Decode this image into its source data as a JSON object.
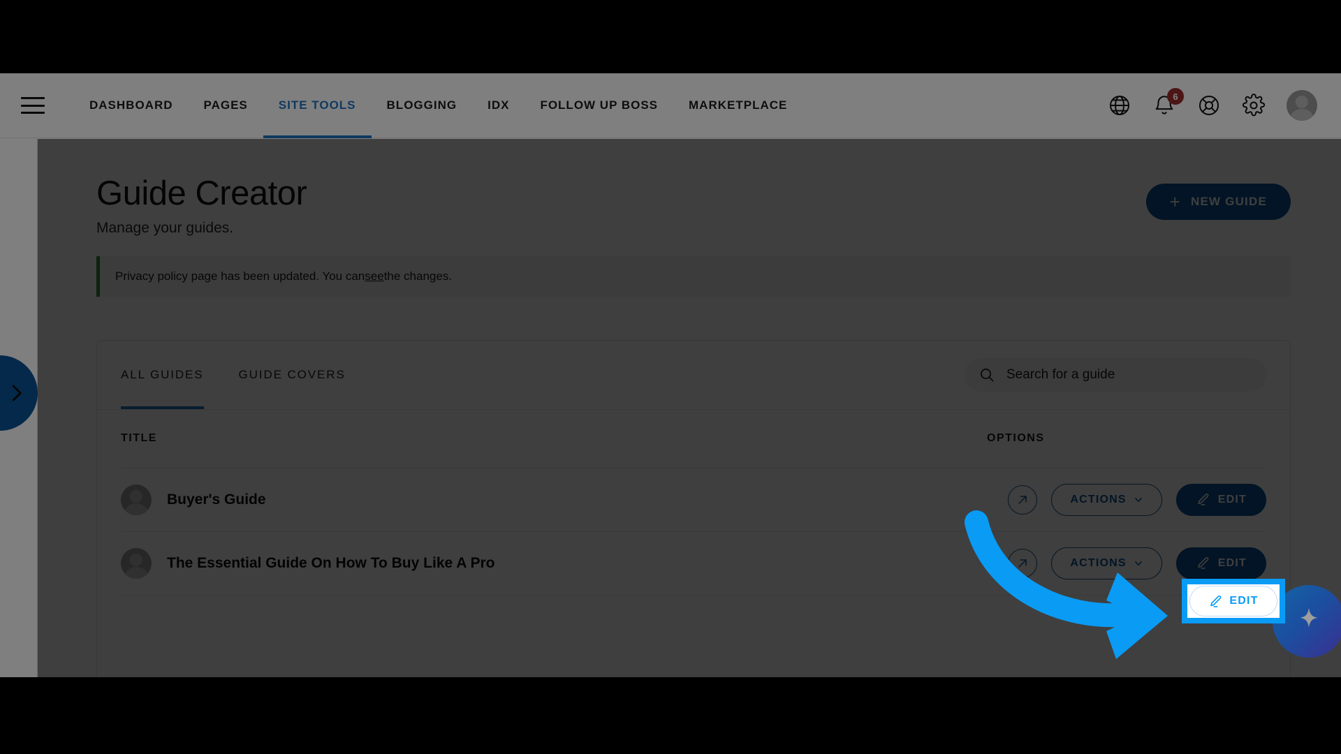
{
  "app": {
    "accent_blue": "#0b5394",
    "link_blue": "#1e73be",
    "highlight_blue": "#0a9bf5",
    "notice_green": "#2e8b3d",
    "badge_red": "#9b2c2c"
  },
  "topnav": {
    "menu_icon": "hamburger-icon",
    "items": [
      {
        "label": "DASHBOARD",
        "active": false
      },
      {
        "label": "PAGES",
        "active": false
      },
      {
        "label": "SITE TOOLS",
        "active": true
      },
      {
        "label": "BLOGGING",
        "active": false
      },
      {
        "label": "IDX",
        "active": false
      },
      {
        "label": "FOLLOW UP BOSS",
        "active": false
      },
      {
        "label": "MARKETPLACE",
        "active": false
      }
    ],
    "icons": [
      {
        "name": "globe-icon"
      },
      {
        "name": "bell-icon",
        "badge": "6"
      },
      {
        "name": "lifebuoy-help-icon"
      },
      {
        "name": "gear-settings-icon"
      },
      {
        "name": "user-avatar"
      }
    ],
    "notification_count": "6"
  },
  "leftrail": {
    "toggle_icon": "chevron-right-icon"
  },
  "header": {
    "title": "Guide Creator",
    "subtitle": "Manage your guides.",
    "new_guide_label": "NEW GUIDE",
    "new_guide_icon": "plus-icon"
  },
  "notice": {
    "text_before": "Privacy policy page has been updated. You can ",
    "link": "see",
    "text_after": " the changes."
  },
  "card": {
    "tabs": [
      {
        "label": "ALL GUIDES",
        "active": true
      },
      {
        "label": "GUIDE COVERS",
        "active": false
      }
    ],
    "search": {
      "placeholder": "Search for a guide",
      "value": "",
      "icon": "search-icon"
    },
    "table": {
      "columns": [
        "TITLE",
        "OPTIONS"
      ],
      "rows": [
        {
          "title": "Buyer's Guide",
          "avatar": "user-avatar",
          "open_icon": "external-link-icon",
          "actions_label": "ACTIONS",
          "actions_caret": "chevron-down-icon",
          "edit_label": "EDIT",
          "edit_icon": "pencil-icon"
        },
        {
          "title": "The Essential Guide On How To Buy Like A Pro",
          "avatar": "user-avatar",
          "open_icon": "external-link-icon",
          "actions_label": "ACTIONS",
          "actions_caret": "chevron-down-icon",
          "edit_label": "EDIT",
          "edit_icon": "pencil-icon"
        }
      ]
    }
  },
  "annotation": {
    "arrow": "curved-blue-arrow",
    "spotlight_target": "EDIT",
    "spotlight_icon": "pencil-icon"
  },
  "fab": {
    "icon": "ai-sparkle-icon"
  }
}
